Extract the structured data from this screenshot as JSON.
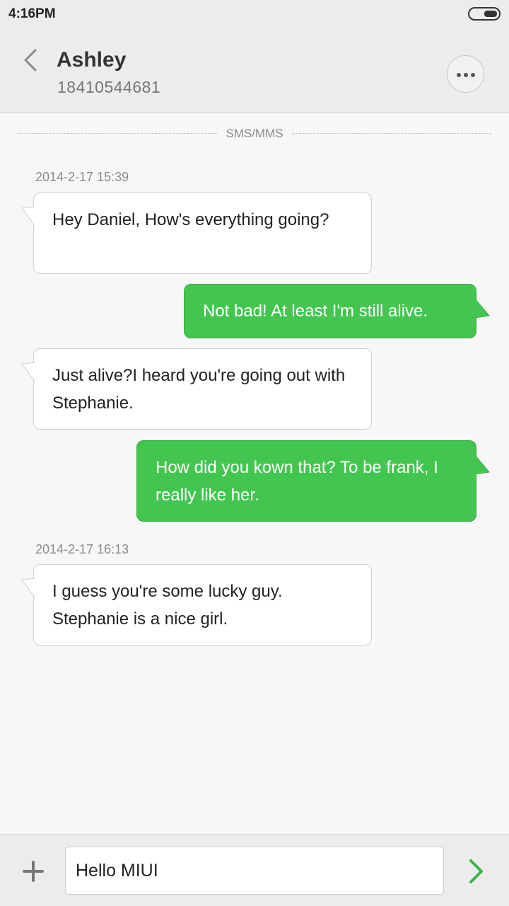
{
  "status_bar": {
    "time": "4:16PM"
  },
  "header": {
    "contact_name": "Ashley",
    "contact_number": "18410544681"
  },
  "divider": {
    "label": "SMS/MMS"
  },
  "thread": {
    "groups": [
      {
        "timestamp": "2014-2-17 15:39",
        "messages": [
          {
            "direction": "incoming",
            "text": "Hey Daniel, How's everything going?"
          },
          {
            "direction": "outgoing",
            "text": "Not bad! At least I'm still alive."
          },
          {
            "direction": "incoming",
            "text": "Just  alive?I heard you're going out with Stephanie."
          },
          {
            "direction": "outgoing",
            "text": "How did you kown that? To be frank, I really like her."
          }
        ]
      },
      {
        "timestamp": "2014-2-17 16:13",
        "messages": [
          {
            "direction": "incoming",
            "text": "I guess you're some lucky guy. Stephanie is a nice girl."
          }
        ]
      }
    ]
  },
  "composer": {
    "value": "Hello MIUI"
  },
  "colors": {
    "outgoing_bubble": "#43c64f",
    "send_arrow": "#3cb34a"
  },
  "icons": {
    "back": "chevron-left-icon",
    "more": "more-dots-icon",
    "attach": "plus-icon",
    "send": "chevron-right-icon"
  }
}
